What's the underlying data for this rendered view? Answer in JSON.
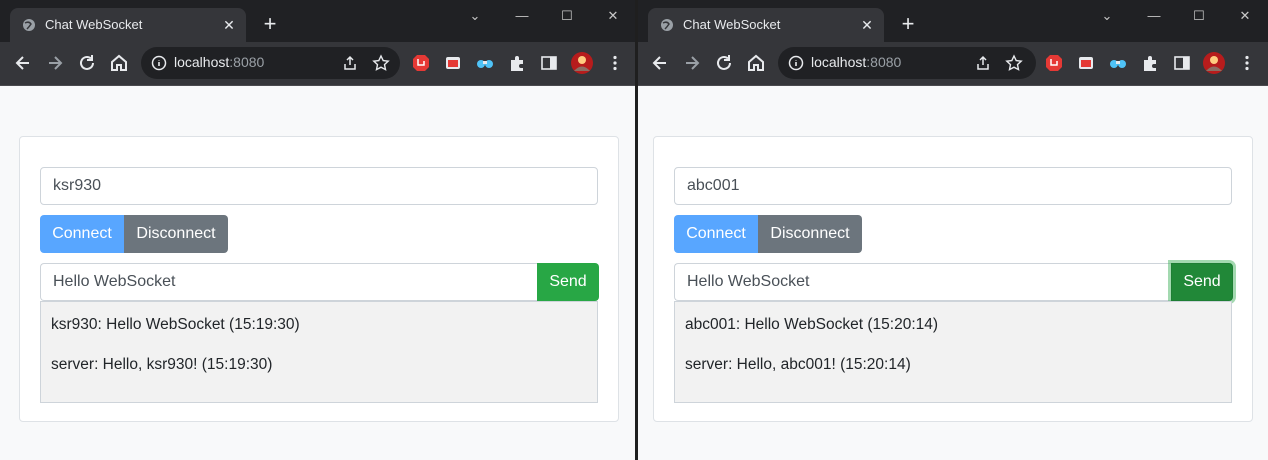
{
  "windows": [
    {
      "tab_title": "Chat WebSocket",
      "url_host": "localhost",
      "url_port": ":8080",
      "username": "ksr930",
      "connect_label": "Connect",
      "disconnect_label": "Disconnect",
      "message": "Hello WebSocket",
      "send_label": "Send",
      "log": [
        "ksr930: Hello WebSocket (15:19:30)",
        "server: Hello, ksr930! (15:19:30)"
      ]
    },
    {
      "tab_title": "Chat WebSocket",
      "url_host": "localhost",
      "url_port": ":8080",
      "username": "abc001",
      "connect_label": "Connect",
      "disconnect_label": "Disconnect",
      "message": "Hello WebSocket",
      "send_label": "Send",
      "log": [
        "abc001: Hello WebSocket (15:20:14)",
        "server: Hello, abc001! (15:20:14)"
      ]
    }
  ],
  "icons": {
    "window_controls": [
      "chevron-down-icon",
      "minimize-icon",
      "maximize-icon",
      "close-icon"
    ],
    "nav": [
      "back-icon",
      "forward-icon",
      "reload-icon",
      "home-icon"
    ],
    "extensions": [
      "adblock-icon",
      "screenshot-icon",
      "binoculars-icon",
      "puzzle-icon",
      "sidepanel-icon",
      "avatar",
      "menu-icon"
    ]
  },
  "colors": {
    "connect": "#58a6ff",
    "disconnect": "#6c757d",
    "send": "#28a745",
    "chrome_dark": "#35363a"
  }
}
